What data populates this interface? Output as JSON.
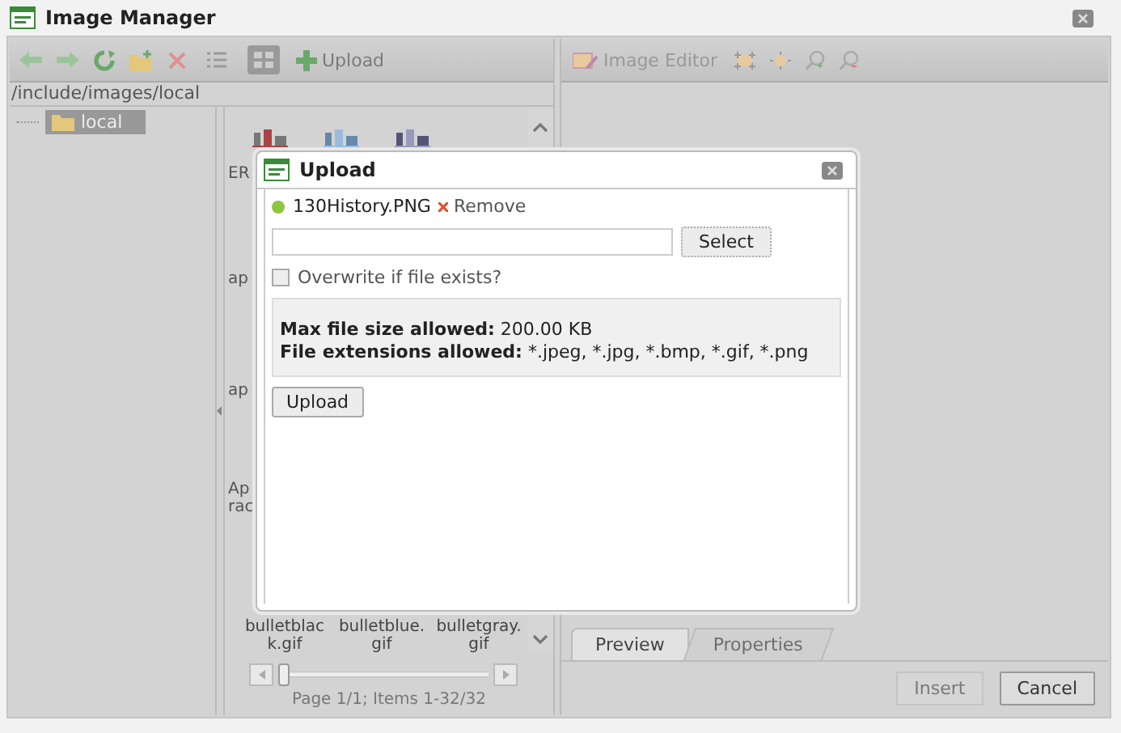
{
  "window": {
    "title": "Image Manager"
  },
  "toolbar": {
    "view_modes": [
      {
        "kind": "list",
        "selected": false
      },
      {
        "kind": "thumbnails",
        "selected": true
      }
    ],
    "upload_label": "Upload"
  },
  "path": "/include/images/local",
  "tree": [
    {
      "label": "local",
      "selected": true
    }
  ],
  "file_fragments": [
    {
      "label": "ER"
    },
    {
      "label": "ap"
    },
    {
      "label": "ap"
    },
    {
      "label": "Ap rac"
    }
  ],
  "files": [
    {
      "name": "bulletblack.gif"
    },
    {
      "name": "bulletblue.gif"
    },
    {
      "name": "bulletgray.gif"
    }
  ],
  "pager": {
    "level": 0,
    "text": "Page 1/1; Items 1-32/32"
  },
  "editor_toolbar": {
    "label": "Image Editor"
  },
  "tabs": [
    {
      "label": "Preview",
      "selected": true
    },
    {
      "label": "Properties",
      "selected": false
    }
  ],
  "buttons": [
    {
      "label": "Insert",
      "disabled": true
    },
    {
      "label": "Cancel",
      "disabled": false
    }
  ],
  "dialog": {
    "title": "Upload",
    "file": {
      "name": "130History.PNG",
      "remove_label": "Remove"
    },
    "select_label": "Select",
    "overwrite": {
      "label": "Overwrite if file exists?",
      "checked": false
    },
    "info": [
      "**Max file size allowed:** 200.00 KB",
      "**File extensions allowed:** *.jpeg, *.jpg, *.bmp, *.gif, *.png"
    ],
    "upload_label": "Upload"
  }
}
